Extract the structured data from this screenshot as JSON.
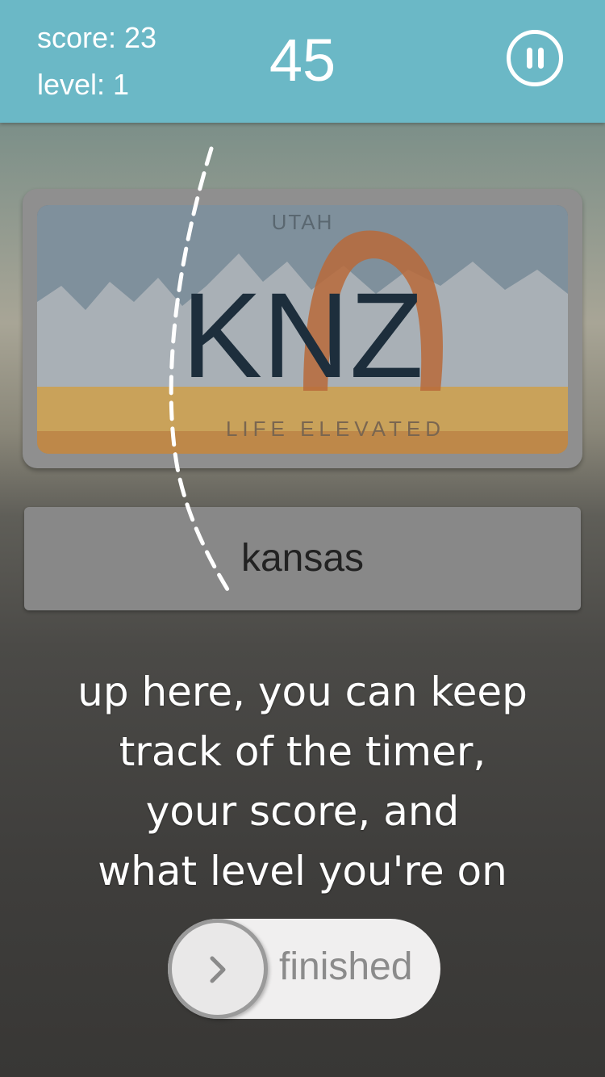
{
  "header": {
    "score": "score: 23",
    "level": "level: 1",
    "timer": "45"
  },
  "plate": {
    "state": "UTAH",
    "number": "KNZ",
    "slogan": "LIFE ELEVATED"
  },
  "answer": {
    "text": "kansas"
  },
  "tutorial": {
    "lines": [
      "up here, you can keep",
      "track of the timer,",
      "your score, and",
      "what level you're on"
    ]
  },
  "slider": {
    "label": "finished"
  },
  "icons": {
    "pause": "pause-icon",
    "chevron": "chevron-right-icon"
  },
  "colors": {
    "header": "#6bb8c6",
    "plate_text": "#1d2e3c"
  }
}
